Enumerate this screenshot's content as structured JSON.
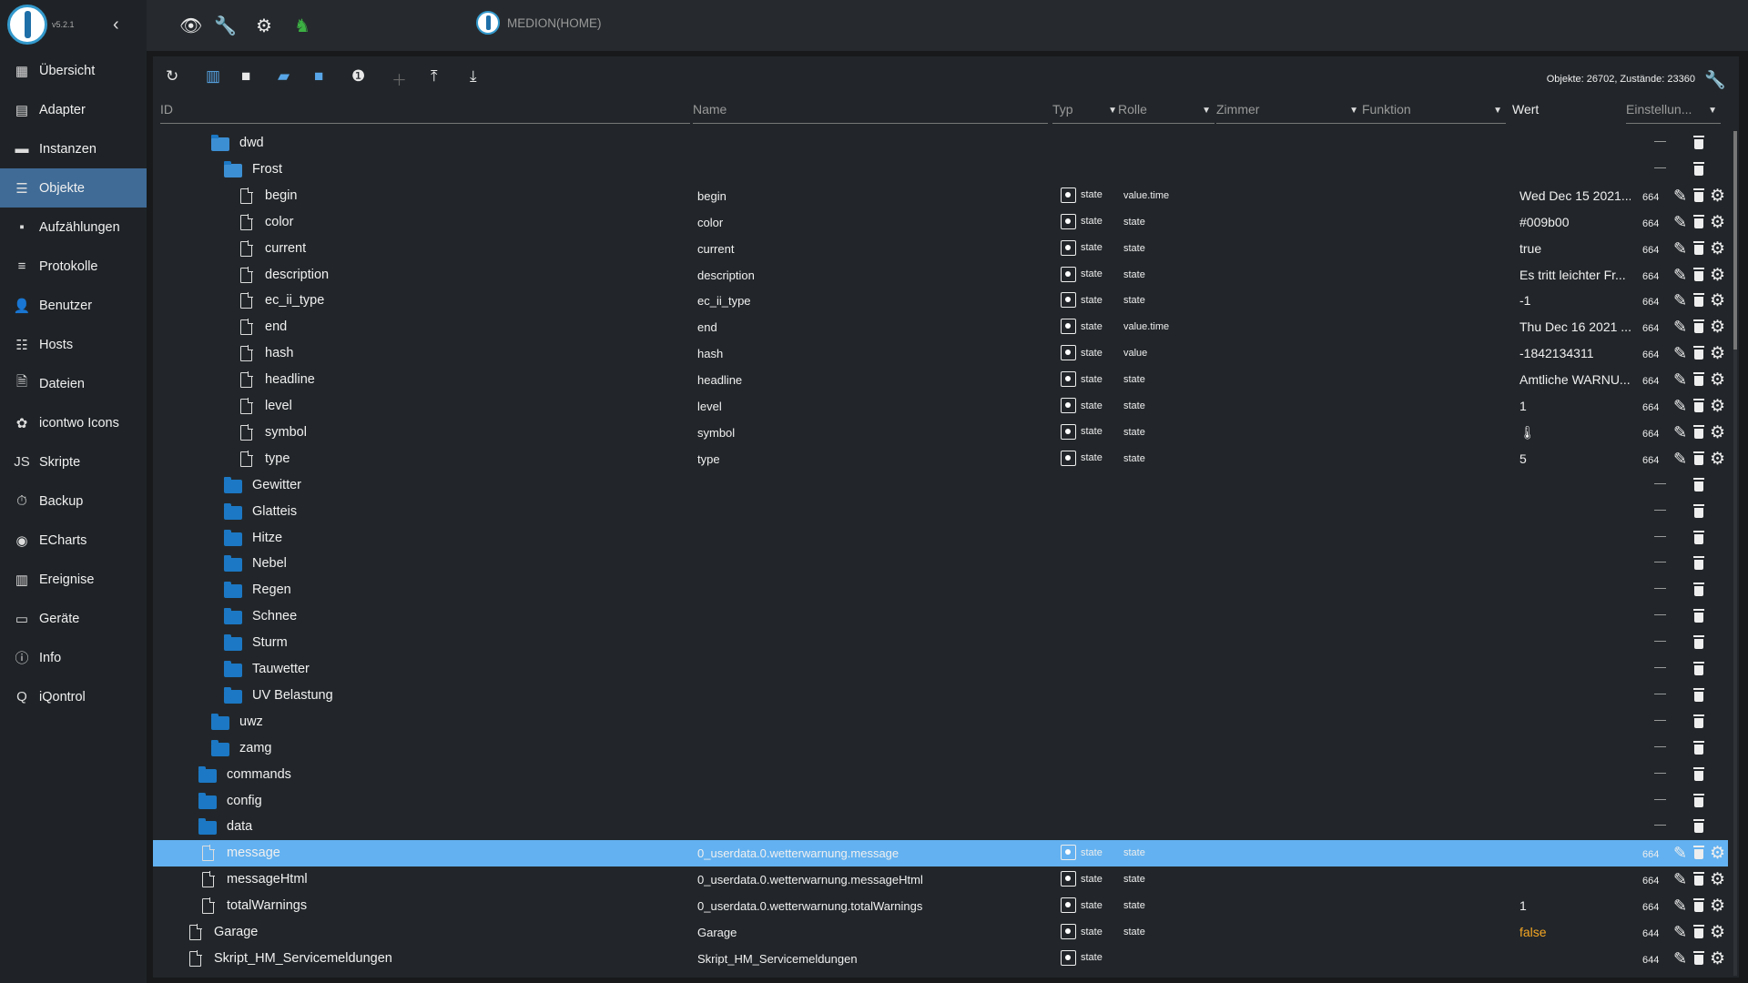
{
  "app": {
    "version": "v5.2.1",
    "host": "MEDION(HOME)"
  },
  "sidebar": {
    "items": [
      {
        "label": "Übersicht",
        "icon": "grid-icon",
        "glyph": "▦"
      },
      {
        "label": "Adapter",
        "icon": "store-icon",
        "glyph": "▤"
      },
      {
        "label": "Instanzen",
        "icon": "instances-icon",
        "glyph": "▬"
      },
      {
        "label": "Objekte",
        "icon": "list-icon",
        "glyph": "☰"
      },
      {
        "label": "Aufzählungen",
        "icon": "enum-icon",
        "glyph": "▪"
      },
      {
        "label": "Protokolle",
        "icon": "log-icon",
        "glyph": "≡"
      },
      {
        "label": "Benutzer",
        "icon": "user-icon",
        "glyph": "👤"
      },
      {
        "label": "Hosts",
        "icon": "hosts-icon",
        "glyph": "☷"
      },
      {
        "label": "Dateien",
        "icon": "files-icon",
        "glyph": "🗎"
      },
      {
        "label": "icontwo Icons",
        "icon": "icontwo-icon",
        "glyph": "✿"
      },
      {
        "label": "Skripte",
        "icon": "js-icon",
        "glyph": "JS"
      },
      {
        "label": "Backup",
        "icon": "backup-icon",
        "glyph": "⏱"
      },
      {
        "label": "ECharts",
        "icon": "echarts-icon",
        "glyph": "◉"
      },
      {
        "label": "Ereignise",
        "icon": "events-icon",
        "glyph": "▥"
      },
      {
        "label": "Geräte",
        "icon": "devices-icon",
        "glyph": "▭"
      },
      {
        "label": "Info",
        "icon": "info-icon",
        "glyph": "ⓘ"
      },
      {
        "label": "iQontrol",
        "icon": "iqontrol-icon",
        "glyph": "Q"
      }
    ]
  },
  "toolbar": {
    "counts": "Objekte: 26702, Zustände: 23360"
  },
  "table": {
    "headers": {
      "id": "ID",
      "name": "Name",
      "typ": "Typ",
      "rolle": "Rolle",
      "zimmer": "Zimmer",
      "funktion": "Funktion",
      "wert": "Wert",
      "einstellungen": "Einstellun..."
    },
    "rows": [
      {
        "kind": "folder-open",
        "depth": 2,
        "id": "dwd",
        "name": "",
        "typ": "",
        "role": "",
        "value": "",
        "acl": ""
      },
      {
        "kind": "folder-open",
        "depth": 3,
        "id": "Frost",
        "name": "",
        "typ": "",
        "role": "",
        "value": "",
        "acl": ""
      },
      {
        "kind": "file",
        "depth": 4,
        "id": "begin",
        "name": "begin",
        "typ": "state",
        "role": "value.time",
        "value": "Wed Dec 15 2021...",
        "acl": "664"
      },
      {
        "kind": "file",
        "depth": 4,
        "id": "color",
        "name": "color",
        "typ": "state",
        "role": "state",
        "value": "#009b00",
        "acl": "664"
      },
      {
        "kind": "file",
        "depth": 4,
        "id": "current",
        "name": "current",
        "typ": "state",
        "role": "state",
        "value": "true",
        "acl": "664"
      },
      {
        "kind": "file",
        "depth": 4,
        "id": "description",
        "name": "description",
        "typ": "state",
        "role": "state",
        "value": "Es tritt leichter Fr...",
        "acl": "664"
      },
      {
        "kind": "file",
        "depth": 4,
        "id": "ec_ii_type",
        "name": "ec_ii_type",
        "typ": "state",
        "role": "state",
        "value": "-1",
        "acl": "664"
      },
      {
        "kind": "file",
        "depth": 4,
        "id": "end",
        "name": "end",
        "typ": "state",
        "role": "value.time",
        "value": "Thu Dec 16 2021 ...",
        "acl": "664"
      },
      {
        "kind": "file",
        "depth": 4,
        "id": "hash",
        "name": "hash",
        "typ": "state",
        "role": "value",
        "value": "-1842134311",
        "acl": "664"
      },
      {
        "kind": "file",
        "depth": 4,
        "id": "headline",
        "name": "headline",
        "typ": "state",
        "role": "state",
        "value": "Amtliche WARNU...",
        "acl": "664"
      },
      {
        "kind": "file",
        "depth": 4,
        "id": "level",
        "name": "level",
        "typ": "state",
        "role": "state",
        "value": "1",
        "acl": "664"
      },
      {
        "kind": "file",
        "depth": 4,
        "id": "symbol",
        "name": "symbol",
        "typ": "state",
        "role": "state",
        "value": "🌡",
        "acl": "664"
      },
      {
        "kind": "file",
        "depth": 4,
        "id": "type",
        "name": "type",
        "typ": "state",
        "role": "state",
        "value": "5",
        "acl": "664"
      },
      {
        "kind": "folder",
        "depth": 3,
        "id": "Gewitter",
        "name": "",
        "typ": "",
        "role": "",
        "value": "",
        "acl": ""
      },
      {
        "kind": "folder",
        "depth": 3,
        "id": "Glatteis",
        "name": "",
        "typ": "",
        "role": "",
        "value": "",
        "acl": ""
      },
      {
        "kind": "folder",
        "depth": 3,
        "id": "Hitze",
        "name": "",
        "typ": "",
        "role": "",
        "value": "",
        "acl": ""
      },
      {
        "kind": "folder",
        "depth": 3,
        "id": "Nebel",
        "name": "",
        "typ": "",
        "role": "",
        "value": "",
        "acl": ""
      },
      {
        "kind": "folder",
        "depth": 3,
        "id": "Regen",
        "name": "",
        "typ": "",
        "role": "",
        "value": "",
        "acl": ""
      },
      {
        "kind": "folder",
        "depth": 3,
        "id": "Schnee",
        "name": "",
        "typ": "",
        "role": "",
        "value": "",
        "acl": ""
      },
      {
        "kind": "folder",
        "depth": 3,
        "id": "Sturm",
        "name": "",
        "typ": "",
        "role": "",
        "value": "",
        "acl": ""
      },
      {
        "kind": "folder",
        "depth": 3,
        "id": "Tauwetter",
        "name": "",
        "typ": "",
        "role": "",
        "value": "",
        "acl": ""
      },
      {
        "kind": "folder",
        "depth": 3,
        "id": "UV Belastung",
        "name": "",
        "typ": "",
        "role": "",
        "value": "",
        "acl": ""
      },
      {
        "kind": "folder",
        "depth": 2,
        "id": "uwz",
        "name": "",
        "typ": "",
        "role": "",
        "value": "",
        "acl": ""
      },
      {
        "kind": "folder",
        "depth": 2,
        "id": "zamg",
        "name": "",
        "typ": "",
        "role": "",
        "value": "",
        "acl": ""
      },
      {
        "kind": "folder",
        "depth": 1,
        "id": "commands",
        "name": "",
        "typ": "",
        "role": "",
        "value": "",
        "acl": ""
      },
      {
        "kind": "folder",
        "depth": 1,
        "id": "config",
        "name": "",
        "typ": "",
        "role": "",
        "value": "",
        "acl": ""
      },
      {
        "kind": "folder",
        "depth": 1,
        "id": "data",
        "name": "",
        "typ": "",
        "role": "",
        "value": "",
        "acl": ""
      },
      {
        "kind": "file",
        "depth": 1,
        "id": "message",
        "name": "0_userdata.0.wetterwarnung.message",
        "typ": "state",
        "role": "state",
        "value": "",
        "acl": "664",
        "selected": true
      },
      {
        "kind": "file",
        "depth": 1,
        "id": "messageHtml",
        "name": "0_userdata.0.wetterwarnung.messageHtml",
        "typ": "state",
        "role": "state",
        "value": "",
        "acl": "664"
      },
      {
        "kind": "file",
        "depth": 1,
        "id": "totalWarnings",
        "name": "0_userdata.0.wetterwarnung.totalWarnings",
        "typ": "state",
        "role": "state",
        "value": "1",
        "acl": "664"
      },
      {
        "kind": "file",
        "depth": 0,
        "id": "Garage",
        "name": "Garage",
        "typ": "state",
        "role": "state",
        "value": "false",
        "acl": "644",
        "value_color": "#f5a623"
      },
      {
        "kind": "file",
        "depth": 0,
        "id": "Skript_HM_Servicemeldungen",
        "name": "Skript_HM_Servicemeldungen",
        "typ": "state",
        "role": "",
        "value": "",
        "acl": "644"
      }
    ]
  }
}
